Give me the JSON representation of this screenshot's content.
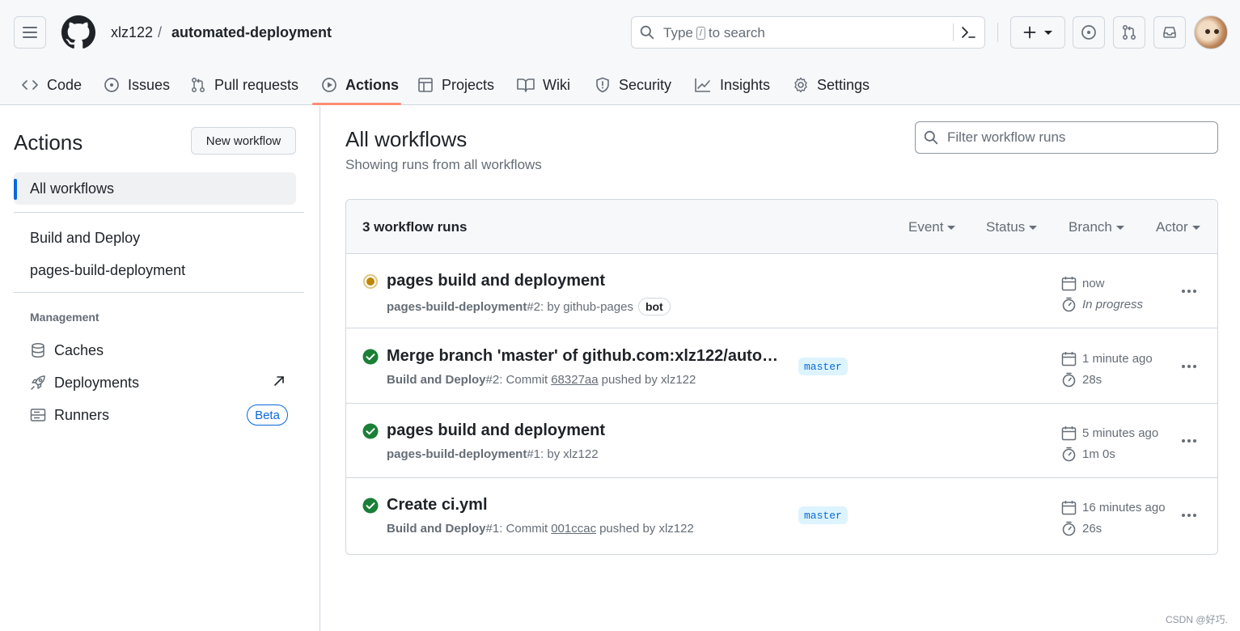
{
  "header": {
    "owner": "xlz122",
    "separator": "/",
    "repo": "automated-deployment",
    "search": {
      "prefix": "Type",
      "key": "/",
      "suffix": "to search"
    }
  },
  "tabs": [
    {
      "label": "Code",
      "icon": "code-icon"
    },
    {
      "label": "Issues",
      "icon": "issue-icon"
    },
    {
      "label": "Pull requests",
      "icon": "pull-request-icon"
    },
    {
      "label": "Actions",
      "icon": "play-icon",
      "active": true
    },
    {
      "label": "Projects",
      "icon": "table-icon"
    },
    {
      "label": "Wiki",
      "icon": "book-icon"
    },
    {
      "label": "Security",
      "icon": "shield-icon"
    },
    {
      "label": "Insights",
      "icon": "graph-icon"
    },
    {
      "label": "Settings",
      "icon": "gear-icon"
    }
  ],
  "sidebar": {
    "title": "Actions",
    "new_workflow": "New workflow",
    "all_workflows": "All workflows",
    "workflows": [
      "Build and Deploy",
      "pages-build-deployment"
    ],
    "management_heading": "Management",
    "management": [
      {
        "label": "Caches",
        "icon": "database-icon"
      },
      {
        "label": "Deployments",
        "icon": "rocket-icon"
      },
      {
        "label": "Runners",
        "icon": "server-icon",
        "badge": "Beta"
      }
    ]
  },
  "main": {
    "title": "All workflows",
    "subtitle": "Showing runs from all workflows",
    "filter_placeholder": "Filter workflow runs",
    "runs_count": "3 workflow runs",
    "filters": [
      "Event",
      "Status",
      "Branch",
      "Actor"
    ],
    "runs": [
      {
        "status": "in-progress",
        "title": "pages build and deployment",
        "workflow": "pages-build-deployment",
        "number": "#2",
        "meta_prefix": ": by",
        "actor": "github-pages",
        "bot_label": "bot",
        "branch": "",
        "time": "now",
        "duration": "In progress"
      },
      {
        "status": "success",
        "title": "Merge branch 'master' of github.com:xlz122/autom...",
        "workflow": "Build and Deploy",
        "number": "#2",
        "meta_prefix": ": Commit",
        "commit": "68327aa",
        "meta_suffix": "pushed by xlz122",
        "branch": "master",
        "time": "1 minute ago",
        "duration": "28s"
      },
      {
        "status": "success",
        "title": "pages build and deployment",
        "workflow": "pages-build-deployment",
        "number": "#1",
        "meta_prefix": ": by",
        "actor": "xlz122",
        "branch": "",
        "time": "5 minutes ago",
        "duration": "1m 0s"
      },
      {
        "status": "success",
        "title": "Create ci.yml",
        "workflow": "Build and Deploy",
        "number": "#1",
        "meta_prefix": ": Commit",
        "commit": "001ccac",
        "meta_suffix": "pushed by xlz122",
        "branch": "master",
        "time": "16 minutes ago",
        "duration": "26s"
      }
    ]
  },
  "colors": {
    "accent": "#0969da",
    "tab_underline": "#fd8c73",
    "success": "#1a7f37",
    "in_progress": "#bf8700"
  },
  "watermark": "CSDN @好巧."
}
